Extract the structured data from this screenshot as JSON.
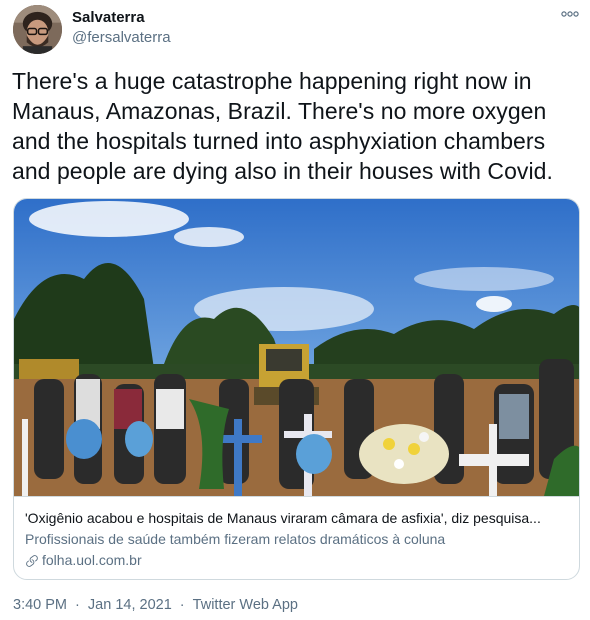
{
  "author": {
    "name": "Salvaterra",
    "handle": "@fersalvaterra"
  },
  "tweet": {
    "text": "There's a huge catastrophe happening right now in Manaus, Amazonas, Brazil. There's no more oxygen and the hospitals turned into asphyxiation chambers and people are dying also in their houses with Covid."
  },
  "card": {
    "title": "'Oxigênio acabou e hospitais de Manaus viraram câmara de asfixia', diz pesquisa...",
    "description": "Profissionais de saúde também fizeram relatos dramáticos à coluna",
    "domain": "folha.uol.com.br",
    "image_icon": "burial-photo"
  },
  "meta": {
    "time": "3:40 PM",
    "separator1": "·",
    "date": "Jan 14, 2021",
    "separator2": "·",
    "source": "Twitter Web App"
  },
  "icons": {
    "more": "more-icon",
    "link": "link-icon"
  },
  "colors": {
    "text": "#0f1419",
    "secondary": "#5b7083",
    "border": "#cfd9de"
  }
}
